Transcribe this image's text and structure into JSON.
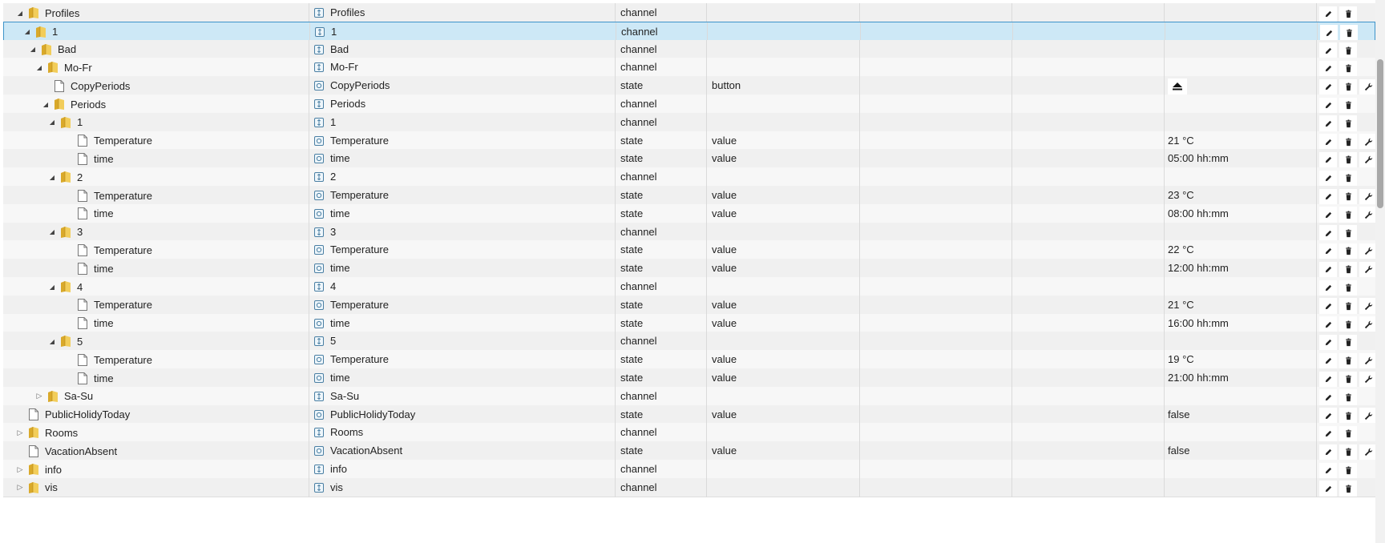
{
  "colors": {
    "selected_bg": "#cde8f6",
    "selected_border": "#3d93c9",
    "folder": "#e9c23f"
  },
  "icons": {
    "channel": "channel-type-icon",
    "state": "state-type-icon",
    "edit": "pencil-icon",
    "delete": "trash-icon",
    "settings": "wrench-icon",
    "button_value": "eject-icon"
  },
  "rows": [
    {
      "name": "Profiles",
      "level": 0,
      "toggle": "open",
      "kind": "folder",
      "display_name": "Profiles",
      "type": "channel",
      "role": "",
      "value": "",
      "settings": false
    },
    {
      "name": "1",
      "level": 1,
      "toggle": "open",
      "kind": "folder",
      "display_name": "1",
      "type": "channel",
      "role": "",
      "value": "",
      "settings": false,
      "selected": true
    },
    {
      "name": "Bad",
      "level": 2,
      "toggle": "open",
      "kind": "folder",
      "display_name": "Bad",
      "type": "channel",
      "role": "",
      "value": "",
      "settings": false
    },
    {
      "name": "Mo-Fr",
      "level": 3,
      "toggle": "open",
      "kind": "folder",
      "display_name": "Mo-Fr",
      "type": "channel",
      "role": "",
      "value": "",
      "settings": false
    },
    {
      "name": "CopyPeriods",
      "level": 4,
      "toggle": "none",
      "kind": "file",
      "display_name": "CopyPeriods",
      "type": "state",
      "role": "button",
      "value": "",
      "value_button": true,
      "settings": true
    },
    {
      "name": "Periods",
      "level": 4,
      "toggle": "open",
      "kind": "folder",
      "display_name": "Periods",
      "type": "channel",
      "role": "",
      "value": "",
      "settings": false
    },
    {
      "name": "1",
      "level": 5,
      "toggle": "open",
      "kind": "folder",
      "display_name": "1",
      "type": "channel",
      "role": "",
      "value": "",
      "settings": false
    },
    {
      "name": "Temperature",
      "level": 6,
      "toggle": "none",
      "kind": "file",
      "display_name": "Temperature",
      "type": "state",
      "role": "value",
      "value": "21 °C",
      "settings": true
    },
    {
      "name": "time",
      "level": 6,
      "toggle": "none",
      "kind": "file",
      "display_name": "time",
      "type": "state",
      "role": "value",
      "value": "05:00 hh:mm",
      "settings": true
    },
    {
      "name": "2",
      "level": 5,
      "toggle": "open",
      "kind": "folder",
      "display_name": "2",
      "type": "channel",
      "role": "",
      "value": "",
      "settings": false
    },
    {
      "name": "Temperature",
      "level": 6,
      "toggle": "none",
      "kind": "file",
      "display_name": "Temperature",
      "type": "state",
      "role": "value",
      "value": "23 °C",
      "settings": true
    },
    {
      "name": "time",
      "level": 6,
      "toggle": "none",
      "kind": "file",
      "display_name": "time",
      "type": "state",
      "role": "value",
      "value": "08:00 hh:mm",
      "settings": true
    },
    {
      "name": "3",
      "level": 5,
      "toggle": "open",
      "kind": "folder",
      "display_name": "3",
      "type": "channel",
      "role": "",
      "value": "",
      "settings": false
    },
    {
      "name": "Temperature",
      "level": 6,
      "toggle": "none",
      "kind": "file",
      "display_name": "Temperature",
      "type": "state",
      "role": "value",
      "value": "22 °C",
      "settings": true
    },
    {
      "name": "time",
      "level": 6,
      "toggle": "none",
      "kind": "file",
      "display_name": "time",
      "type": "state",
      "role": "value",
      "value": "12:00 hh:mm",
      "settings": true
    },
    {
      "name": "4",
      "level": 5,
      "toggle": "open",
      "kind": "folder",
      "display_name": "4",
      "type": "channel",
      "role": "",
      "value": "",
      "settings": false
    },
    {
      "name": "Temperature",
      "level": 6,
      "toggle": "none",
      "kind": "file",
      "display_name": "Temperature",
      "type": "state",
      "role": "value",
      "value": "21 °C",
      "settings": true
    },
    {
      "name": "time",
      "level": 6,
      "toggle": "none",
      "kind": "file",
      "display_name": "time",
      "type": "state",
      "role": "value",
      "value": "16:00 hh:mm",
      "settings": true
    },
    {
      "name": "5",
      "level": 5,
      "toggle": "open",
      "kind": "folder",
      "display_name": "5",
      "type": "channel",
      "role": "",
      "value": "",
      "settings": false
    },
    {
      "name": "Temperature",
      "level": 6,
      "toggle": "none",
      "kind": "file",
      "display_name": "Temperature",
      "type": "state",
      "role": "value",
      "value": "19 °C",
      "settings": true
    },
    {
      "name": "time",
      "level": 6,
      "toggle": "none",
      "kind": "file",
      "display_name": "time",
      "type": "state",
      "role": "value",
      "value": "21:00 hh:mm",
      "settings": true
    },
    {
      "name": "Sa-Su",
      "level": 3,
      "toggle": "closed",
      "kind": "folder",
      "display_name": "Sa-Su",
      "type": "channel",
      "role": "",
      "value": "",
      "settings": false
    },
    {
      "name": "PublicHolidyToday",
      "level": 0,
      "toggle": "none",
      "kind": "file",
      "display_name": "PublicHolidyToday",
      "type": "state",
      "role": "value",
      "value": "false",
      "settings": true
    },
    {
      "name": "Rooms",
      "level": 0,
      "toggle": "closed",
      "kind": "folder",
      "display_name": "Rooms",
      "type": "channel",
      "role": "",
      "value": "",
      "settings": false
    },
    {
      "name": "VacationAbsent",
      "level": 0,
      "toggle": "none",
      "kind": "file",
      "display_name": "VacationAbsent",
      "type": "state",
      "role": "value",
      "value": "false",
      "settings": true
    },
    {
      "name": "info",
      "level": 0,
      "toggle": "closed",
      "kind": "folder",
      "display_name": "info",
      "type": "channel",
      "role": "",
      "value": "",
      "settings": false
    },
    {
      "name": "vis",
      "level": 0,
      "toggle": "closed",
      "kind": "folder",
      "display_name": "vis",
      "type": "channel",
      "role": "",
      "value": "",
      "settings": false
    }
  ]
}
